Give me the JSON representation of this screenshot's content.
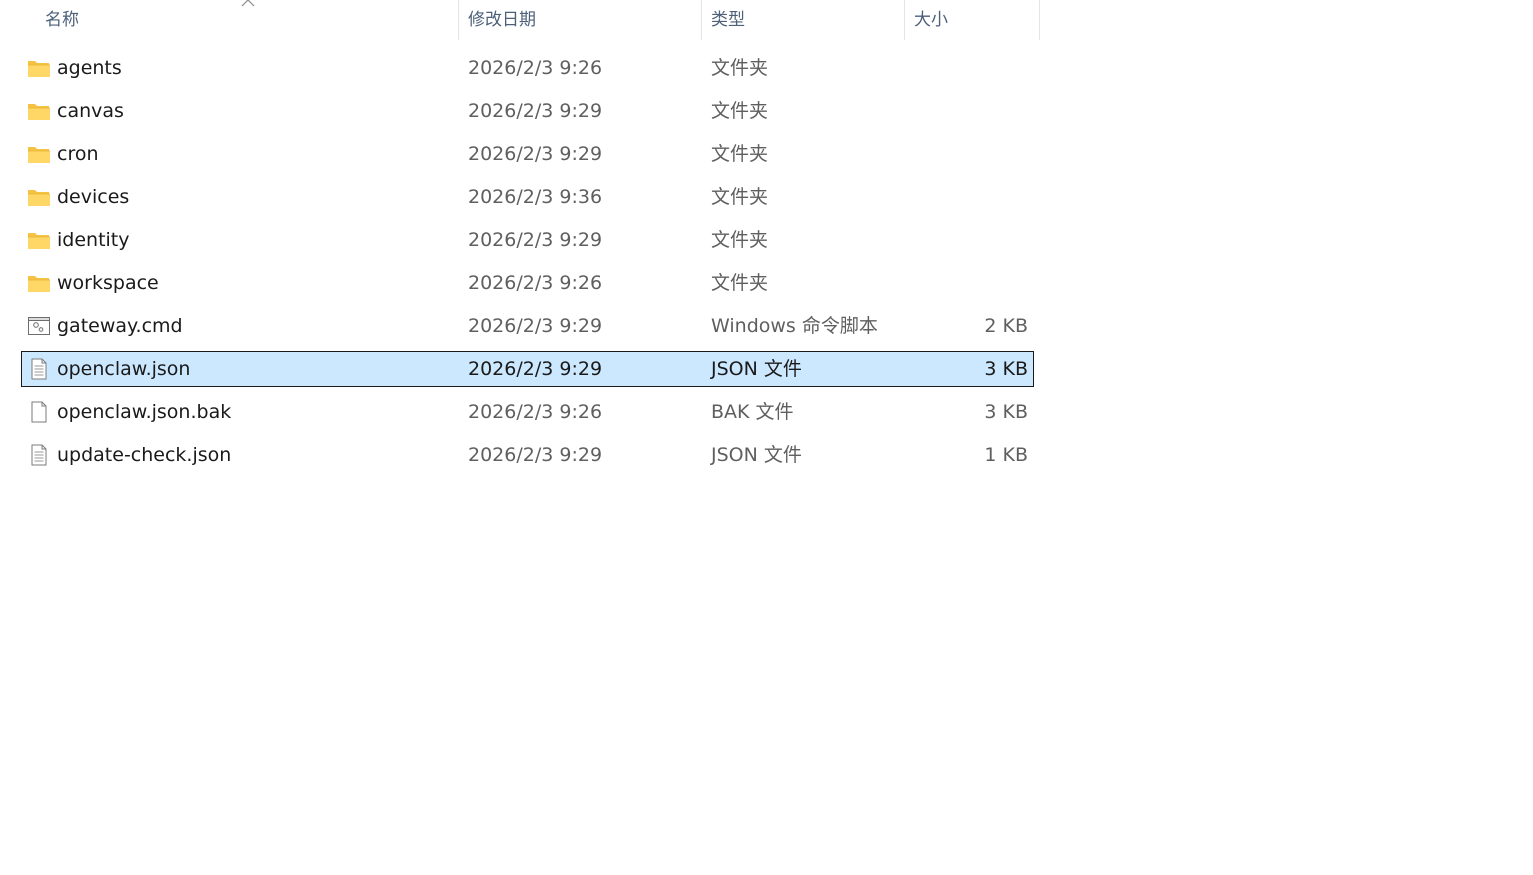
{
  "columns": {
    "name": "名称",
    "date": "修改日期",
    "type": "类型",
    "size": "大小"
  },
  "files": [
    {
      "name": "agents",
      "date": "2026/2/3 9:26",
      "type": "文件夹",
      "size": "",
      "icon": "folder-icon"
    },
    {
      "name": "canvas",
      "date": "2026/2/3 9:29",
      "type": "文件夹",
      "size": "",
      "icon": "folder-icon"
    },
    {
      "name": "cron",
      "date": "2026/2/3 9:29",
      "type": "文件夹",
      "size": "",
      "icon": "folder-icon"
    },
    {
      "name": "devices",
      "date": "2026/2/3 9:36",
      "type": "文件夹",
      "size": "",
      "icon": "folder-icon"
    },
    {
      "name": "identity",
      "date": "2026/2/3 9:29",
      "type": "文件夹",
      "size": "",
      "icon": "folder-icon"
    },
    {
      "name": "workspace",
      "date": "2026/2/3 9:26",
      "type": "文件夹",
      "size": "",
      "icon": "folder-icon"
    },
    {
      "name": "gateway.cmd",
      "date": "2026/2/3 9:29",
      "type": "Windows 命令脚本",
      "size": "2 KB",
      "icon": "cmd-script-icon"
    },
    {
      "name": "openclaw.json",
      "date": "2026/2/3 9:29",
      "type": "JSON 文件",
      "size": "3 KB",
      "icon": "text-file-icon"
    },
    {
      "name": "openclaw.json.bak",
      "date": "2026/2/3 9:26",
      "type": "BAK 文件",
      "size": "3 KB",
      "icon": "blank-file-icon"
    },
    {
      "name": "update-check.json",
      "date": "2026/2/3 9:29",
      "type": "JSON 文件",
      "size": "1 KB",
      "icon": "text-file-icon"
    }
  ],
  "selected_file": "openclaw.json",
  "colors": {
    "selection_bg": "#cce8ff",
    "header_text": "#4c607a",
    "folder_yellow": "#ffd35c"
  }
}
